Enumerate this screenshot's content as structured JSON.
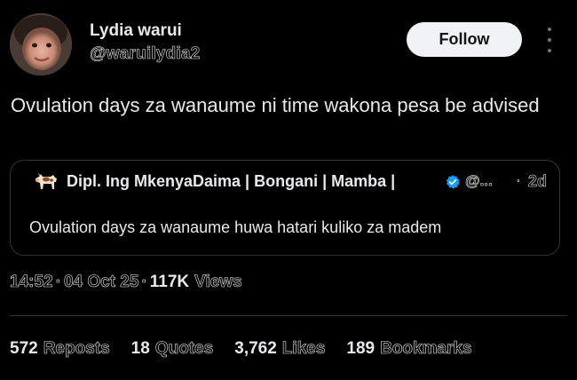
{
  "author": {
    "name": "Lydia warui",
    "handle": "@waruilydia2",
    "avatar": "profile-photo"
  },
  "actions": {
    "follow_label": "Follow",
    "more_icon": "more-vertical-icon"
  },
  "tweet": {
    "text": "Ovulation days za wanaume ni time wakona pesa be advised"
  },
  "quoted": {
    "avatar": "cow-emoji",
    "name": "Dipl. Ing MkenyaDaima | Bongani | Mamba |",
    "verified": true,
    "handle": "@...",
    "dot": "·",
    "time": "2d",
    "text": "Ovulation days za wanaume huwa hatari kuliko za madem"
  },
  "meta": {
    "time": "14:52",
    "date": "04 Oct 25",
    "views": "117K",
    "views_label": "Views",
    "separator": "·"
  },
  "stats": {
    "reposts": {
      "count": "572",
      "label": "Reposts"
    },
    "quotes": {
      "count": "18",
      "label": "Quotes"
    },
    "likes": {
      "count": "3,762",
      "label": "Likes"
    },
    "bookmarks": {
      "count": "189",
      "label": "Bookmarks"
    }
  },
  "colors": {
    "background": "#000000",
    "text": "#e7e9ea",
    "muted": "#71767b",
    "border": "#2f3336",
    "verified": "#1d9bf0",
    "follow_bg": "#eff3f4"
  }
}
